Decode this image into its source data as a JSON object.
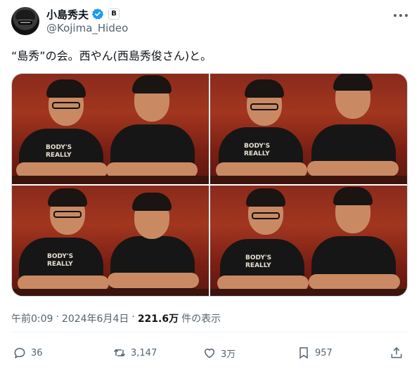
{
  "author": {
    "display_name": "小島秀夫",
    "handle": "@Kojima_Hideo",
    "affiliate_badge": "B",
    "verified_color": "#1d9bf0"
  },
  "tweet": {
    "text": "“島秀”の会。西やん(西島秀俊さん)と。"
  },
  "media": {
    "photos": [
      {
        "print_text": "BODY'S REALLY"
      },
      {
        "print_text": "BODY'S REALLY"
      },
      {
        "print_text": "BODY'S REALLY"
      },
      {
        "print_text": "BODY'S REALLY"
      }
    ]
  },
  "meta": {
    "time": "午前0:09",
    "separator": "·",
    "date": "2024年6月4日",
    "views_count": "221.6万",
    "views_label": "件の表示"
  },
  "actions": {
    "reply_count": "36",
    "repost_count": "3,147",
    "like_count": "3万",
    "bookmark_count": "957"
  },
  "icons": {
    "more": "more-icon",
    "reply": "reply-icon",
    "repost": "repost-icon",
    "like": "heart-icon",
    "bookmark": "bookmark-icon",
    "share": "share-icon"
  }
}
